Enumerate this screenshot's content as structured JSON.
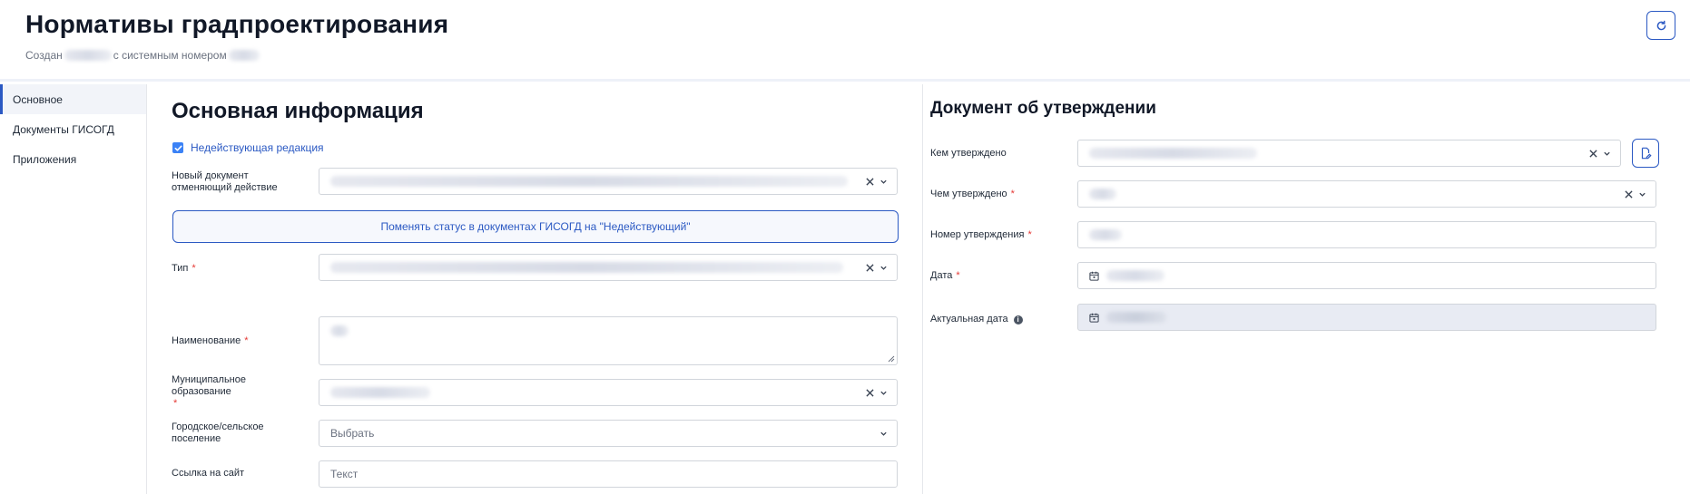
{
  "header": {
    "title": "Нормативы градпроектирования",
    "created_prefix": "Создан",
    "created_middle": "с системным номером"
  },
  "sidebar": {
    "items": [
      {
        "label": "Основное"
      },
      {
        "label": "Документы ГИСОГД"
      },
      {
        "label": "Приложения"
      }
    ]
  },
  "main": {
    "title": "Основная информация",
    "inactive_checkbox_label": "Недействующая редакция",
    "new_doc_label": "Новый документ отменяющий действие",
    "change_status_button": "Поменять статус в документах ГИСОГД на \"Недействующий\"",
    "type_label": "Тип",
    "name_label": "Наименование",
    "municipality_label": "Муниципальное образование",
    "settlement_label": "Городское/сельское поселение",
    "settlement_placeholder": "Выбрать",
    "site_link_label": "Ссылка на сайт",
    "site_link_placeholder": "Текст"
  },
  "approval": {
    "title": "Документ об утверждении",
    "approved_by_label": "Кем утверждено",
    "approved_with_label": "Чем утверждено",
    "approval_number_label": "Номер утверждения",
    "date_label": "Дата",
    "actual_date_label": "Актуальная дата"
  },
  "colors": {
    "accent": "#2b59c3",
    "required": "#e53935"
  }
}
